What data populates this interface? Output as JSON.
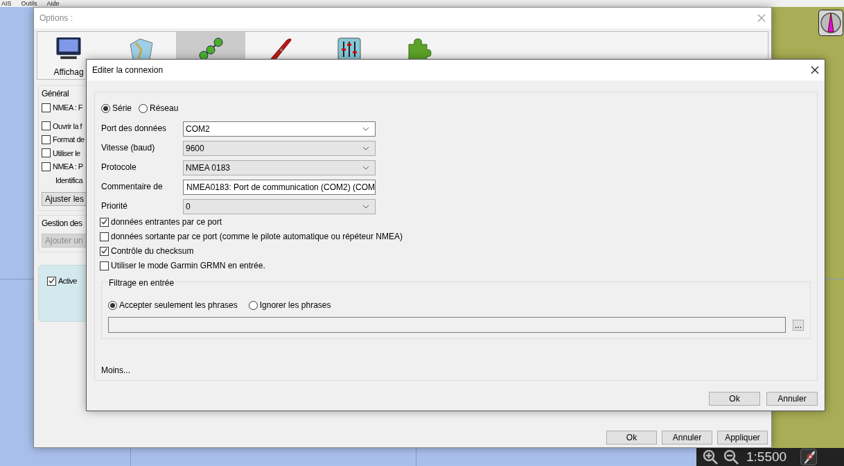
{
  "menu_bar": {
    "items": [
      "AIS",
      "Outils",
      "Aide"
    ]
  },
  "options_window": {
    "title": "Options :",
    "toolbar": [
      {
        "kind": "monitor",
        "label": "Affichag",
        "selected": false
      },
      {
        "kind": "charts",
        "selected": false
      },
      {
        "kind": "connections",
        "selected": true
      },
      {
        "kind": "ship",
        "selected": false
      },
      {
        "kind": "sliders",
        "selected": false
      },
      {
        "kind": "plugin",
        "selected": false
      }
    ],
    "general": {
      "legend": "Général",
      "items": [
        {
          "kind": "checkbox",
          "label": "NMEA : F",
          "checked": false
        },
        {
          "kind": "checkbox",
          "label": "Ouvrir la f",
          "checked": false
        },
        {
          "kind": "checkbox",
          "label": "Format de",
          "checked": false
        },
        {
          "kind": "checkbox",
          "label": "Utiliser le",
          "checked": false
        },
        {
          "kind": "checkbox",
          "label": "NMEA : P",
          "checked": false
        },
        {
          "kind": "text",
          "label": "Identifica"
        },
        {
          "kind": "button",
          "label": "Ajuster les"
        }
      ]
    },
    "connections": {
      "legend": "Gestion des",
      "add_button": {
        "label": "Ajouter un",
        "disabled": true
      },
      "connection": {
        "label": "Active",
        "checked": true
      }
    },
    "buttons": [
      "Ok",
      "Annuler",
      "Appliquer"
    ]
  },
  "dialog": {
    "title": "Editer la connexion",
    "connection_type": [
      {
        "label": "Série",
        "selected": true
      },
      {
        "label": "Réseau",
        "selected": false
      }
    ],
    "fields": [
      {
        "kind": "editable-combo",
        "label": "Port des données",
        "value": "COM2"
      },
      {
        "kind": "combo",
        "label": "Vitesse (baud)",
        "value": "9600"
      },
      {
        "kind": "combo",
        "label": "Protocole",
        "value": "NMEA 0183"
      },
      {
        "kind": "text",
        "label": "Commentaire de",
        "value": "NMEA0183: Port de communication (COM2) (COM"
      },
      {
        "kind": "combo",
        "label": "Priorité",
        "value": "0"
      }
    ],
    "options": [
      {
        "label": "données entrantes par ce port",
        "checked": true
      },
      {
        "label": "données sortante par ce port (comme le pilote automatique ou répéteur NMEA)",
        "checked": false
      },
      {
        "label": "Contrôle du checksum",
        "checked": true
      },
      {
        "label": "Utiliser le mode Garmin GRMN en entrée.",
        "checked": false
      }
    ],
    "filter": {
      "legend": "Filtrage en entrée",
      "modes": [
        {
          "label": "Accepter seulement les phrases",
          "selected": true
        },
        {
          "label": "Ignorer les phrases",
          "selected": false
        }
      ],
      "browse_button": "..."
    },
    "more_link": "Moins...",
    "buttons": [
      "Ok",
      "Annuler"
    ]
  },
  "map": {
    "scale": "1:5500"
  }
}
